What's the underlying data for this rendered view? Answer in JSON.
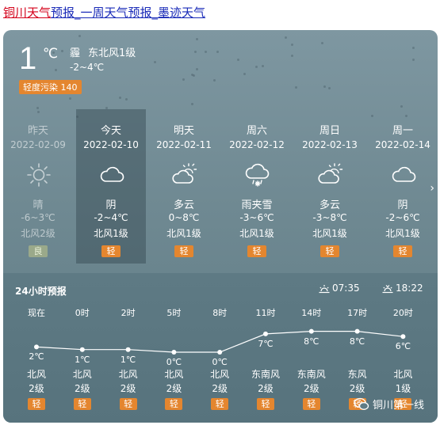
{
  "header": {
    "link_part1": "铜川天气",
    "link_part2": "预报",
    "link_sep1": "_",
    "link_part3": "一周天气预报",
    "link_sep2": "_",
    "link_part4": "墨迹天气"
  },
  "current": {
    "temp": "1",
    "unit": "℃",
    "condition": "霾",
    "wind": "东北风1级",
    "range": "-2~4℃",
    "aqi": "轻度污染 140"
  },
  "days": [
    {
      "name": "昨天",
      "date": "2022-02-09",
      "icon": "sun-icon",
      "cond": "晴",
      "range": "-6~3℃",
      "wind": "北风2级",
      "aq": "良"
    },
    {
      "name": "今天",
      "date": "2022-02-10",
      "icon": "cloud-icon",
      "cond": "阴",
      "range": "-2~4℃",
      "wind": "北风1级",
      "aq": "轻"
    },
    {
      "name": "明天",
      "date": "2022-02-11",
      "icon": "partly-cloudy-icon",
      "cond": "多云",
      "range": "0~8℃",
      "wind": "北风1级",
      "aq": "轻"
    },
    {
      "name": "周六",
      "date": "2022-02-12",
      "icon": "sleet-icon",
      "cond": "雨夹雪",
      "range": "-3~6℃",
      "wind": "北风1级",
      "aq": "轻"
    },
    {
      "name": "周日",
      "date": "2022-02-13",
      "icon": "partly-cloudy-icon",
      "cond": "多云",
      "range": "-3~8℃",
      "wind": "北风1级",
      "aq": "轻"
    },
    {
      "name": "周一",
      "date": "2022-02-14",
      "icon": "cloud-icon",
      "cond": "阴",
      "range": "-2~6℃",
      "wind": "北风1级",
      "aq": "轻"
    }
  ],
  "hourly": {
    "title": "24小时预报",
    "sunrise": "07:35",
    "sunset": "18:22",
    "items": [
      {
        "time": "现在",
        "temp": 2,
        "temp_label": "2℃",
        "wdir": "北风",
        "wlvl": "2级",
        "aq": "轻"
      },
      {
        "time": "0时",
        "temp": 1,
        "temp_label": "1℃",
        "wdir": "北风",
        "wlvl": "2级",
        "aq": "轻"
      },
      {
        "time": "2时",
        "temp": 1,
        "temp_label": "1℃",
        "wdir": "北风",
        "wlvl": "2级",
        "aq": "轻"
      },
      {
        "time": "5时",
        "temp": 0,
        "temp_label": "0℃",
        "wdir": "北风",
        "wlvl": "2级",
        "aq": "轻"
      },
      {
        "time": "8时",
        "temp": 0,
        "temp_label": "0℃",
        "wdir": "北风",
        "wlvl": "2级",
        "aq": "轻"
      },
      {
        "time": "11时",
        "temp": 7,
        "temp_label": "7℃",
        "wdir": "东南风",
        "wlvl": "2级",
        "aq": "轻"
      },
      {
        "time": "14时",
        "temp": 8,
        "temp_label": "8℃",
        "wdir": "东南风",
        "wlvl": "2级",
        "aq": "轻"
      },
      {
        "time": "17时",
        "temp": 8,
        "temp_label": "8℃",
        "wdir": "东风",
        "wlvl": "2级",
        "aq": "轻"
      },
      {
        "time": "20时",
        "temp": 6,
        "temp_label": "6℃",
        "wdir": "北风",
        "wlvl": "1级",
        "aq": "轻"
      }
    ]
  },
  "watermark": "铜川第一线",
  "colors": {
    "aq_orange": "#e4862f",
    "aq_good": "#9aa98a",
    "link_red": "#d4001a",
    "link_blue": "#1a2bb8"
  }
}
